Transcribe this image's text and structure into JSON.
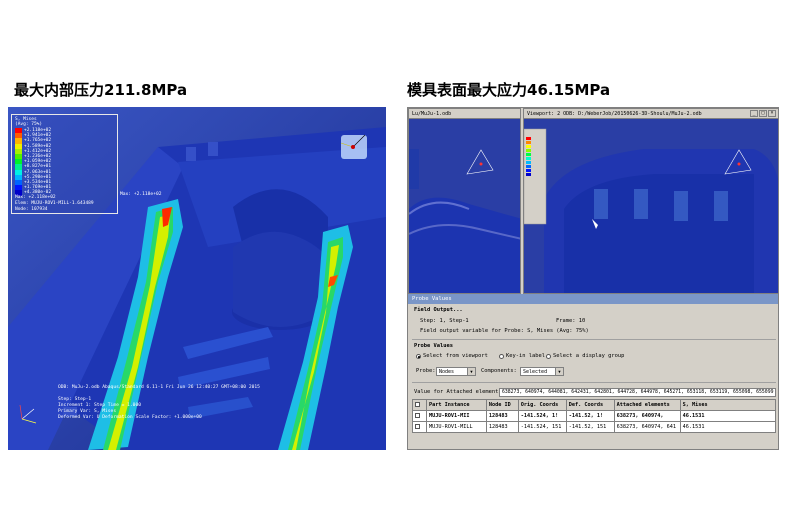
{
  "titles": {
    "left": "最大内部压力211.8MPa",
    "right": "模具表面最大应力46.15MPa"
  },
  "left_view": {
    "legend": {
      "header": [
        "S, Mises",
        "(Avg: 75%)"
      ],
      "values": [
        "+2.118e+02",
        "+1.941e+02",
        "+1.765e+02",
        "+1.589e+02",
        "+1.412e+02",
        "+1.236e+02",
        "+1.059e+02",
        "+8.827e+01",
        "+7.063e+01",
        "+5.298e+01",
        "+3.534e+01",
        "+1.769e+01",
        "+4.380e-02"
      ],
      "colors": [
        "#ff0000",
        "#ff5a00",
        "#ffb400",
        "#f0f000",
        "#a8f000",
        "#50f000",
        "#00f028",
        "#00f08c",
        "#00f0e6",
        "#00b4ff",
        "#0064ff",
        "#0014ff",
        "#0000c8"
      ],
      "max_line": "Max: +2.118e+02",
      "elem_line": "Elem: MUJU-ROV1-MILL-1.643489",
      "node_line": "Node: 107934"
    },
    "max_label": "Max: +2.118e+02",
    "info_lines": [
      "ODB: MuJu-2.odb    Abaqus/Standard 6.11-1    Fri Jun 26 12:40:27 GMT+08:00 2015",
      "",
      "Step: Step-1",
      "Increment    1: Step Time =    1.000",
      "Primary Var: S, Mises",
      "Deformed Var: U   Deformation Scale Factor: +1.000e+00"
    ]
  },
  "right_window": {
    "vp1_title": "Lu/MuJu-1.odb",
    "vp2_title": "Viewport: 2    ODB: D:/WeberJob/20150626-3D-Shoulu/MuJu-2.odb",
    "probe": {
      "window_title": "Probe Values",
      "field_output": "Field Output...",
      "step_label": "Step: 1, Step-1",
      "frame_label": "Frame: 10",
      "field_var": "Field output variable for Probe: S, Mises (Avg: 75%)",
      "probe_values": "Probe Values",
      "radio_options": [
        "Select from viewport",
        "Key-in label",
        "Select a display group"
      ],
      "probe_label": "Probe:",
      "probe_value": "Nodes",
      "components_label": "Components:",
      "components_value": "Selected",
      "attached_label": "Value for Attached elements:",
      "attached_value": "638273, 640974, 644081, 642431, 642801, 644728, 644978, 645271, 653118, 653119, 655098, 655099",
      "columns": [
        "",
        "Part Instance",
        "Node ID",
        "Orig. Coords",
        "Def. Coords",
        "Attached elements",
        "S, Mises"
      ],
      "rows": [
        [
          "",
          "MUJU-ROV1-MII",
          "128483",
          "-141.524, 1!",
          "-141.52, 1!",
          "638273, 640974,",
          "46.1531"
        ],
        [
          "",
          "MUJU-ROV1-MILL",
          "128483",
          "-141.524, 151",
          "-141.52, 151",
          "638273, 640974, 641",
          "46.1531"
        ]
      ]
    }
  }
}
